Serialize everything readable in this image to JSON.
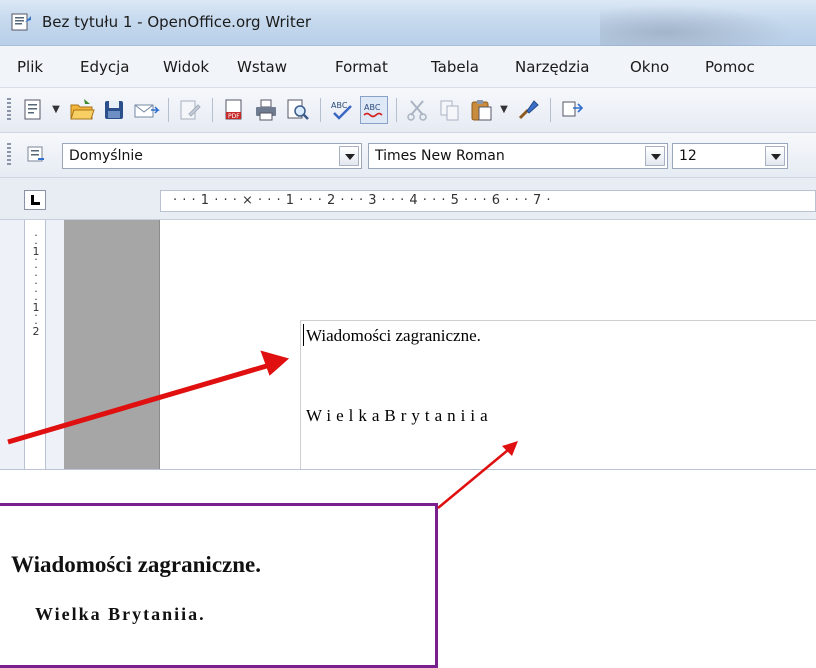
{
  "window": {
    "title": "Bez tytułu 1 - OpenOffice.org Writer"
  },
  "menu": [
    "Plik",
    "Edycja",
    "Widok",
    "Wstaw",
    "Format",
    "Tabela",
    "Narzędzia",
    "Okno",
    "Pomoc"
  ],
  "toolbar": {
    "icons": [
      "new-document-icon",
      "open-folder-icon",
      "save-icon",
      "email-icon",
      "edit-file-icon",
      "export-pdf-icon",
      "print-icon",
      "page-preview-icon",
      "spellcheck-icon",
      "autospellcheck-icon",
      "cut-icon",
      "copy-icon",
      "paste-icon",
      "format-paintbrush-icon"
    ]
  },
  "formatting": {
    "style": "Domyślnie",
    "font": "Times New Roman",
    "size": "12"
  },
  "ruler": {
    "horizontal": "· · · 1 · · · ⨯ · · · 1 · · · 2 · · · 3 · · · 4 · · · 5 · · · 6 · · · 7 ·",
    "vertical": "·\n·\n1\n·\n·\n·\n·\n·\n·\n1\n·\n·\n2"
  },
  "document": {
    "line1": "Wiadomości zagraniczne.",
    "line2": "WielkaBrytaniia"
  },
  "callout": {
    "line1": "Wiadomości zagraniczne.",
    "line2": "Wielka Brytaniia."
  },
  "colors": {
    "arrow": "#e01010",
    "callout_border": "#7a1f8e"
  }
}
